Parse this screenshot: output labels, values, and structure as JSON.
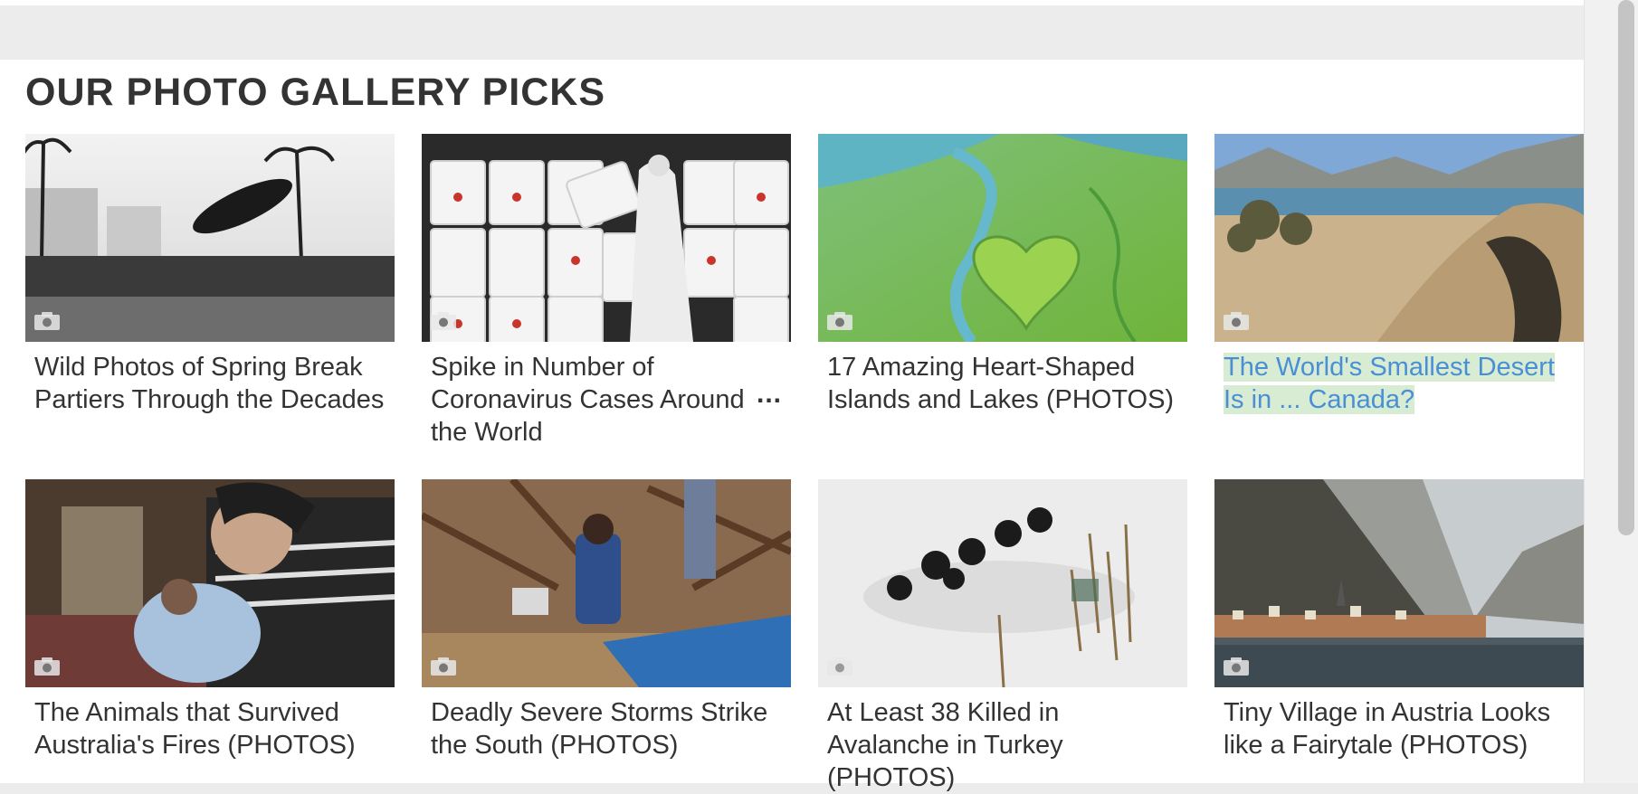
{
  "section": {
    "heading": "OUR PHOTO GALLERY PICKS"
  },
  "gallery": [
    {
      "title": "Wild Photos of Spring Break Partiers Through the Decades",
      "icon": "camera-icon"
    },
    {
      "title": "Spike in Number of Coronavirus Cases Around the World",
      "more": "...",
      "icon": "camera-icon"
    },
    {
      "title": "17 Amazing Heart-Shaped Islands and Lakes (PHOTOS)",
      "icon": "camera-icon"
    },
    {
      "title": "The World's Smallest Desert Is in ... Canada?",
      "icon": "camera-icon",
      "highlighted": true
    },
    {
      "title": "The Animals that Survived Australia's Fires (PHOTOS)",
      "icon": "camera-icon"
    },
    {
      "title": "Deadly Severe Storms Strike the South (PHOTOS)",
      "icon": "camera-icon"
    },
    {
      "title": "At Least 38 Killed in Avalanche in Turkey (PHOTOS)",
      "icon": "camera-icon"
    },
    {
      "title": "Tiny Village in Austria Looks like a Fairytale (PHOTOS)",
      "icon": "camera-icon"
    }
  ],
  "colors": {
    "highlight_text": "#4a8fd6",
    "highlight_bg": "#d7ecd2",
    "text": "#333333"
  }
}
